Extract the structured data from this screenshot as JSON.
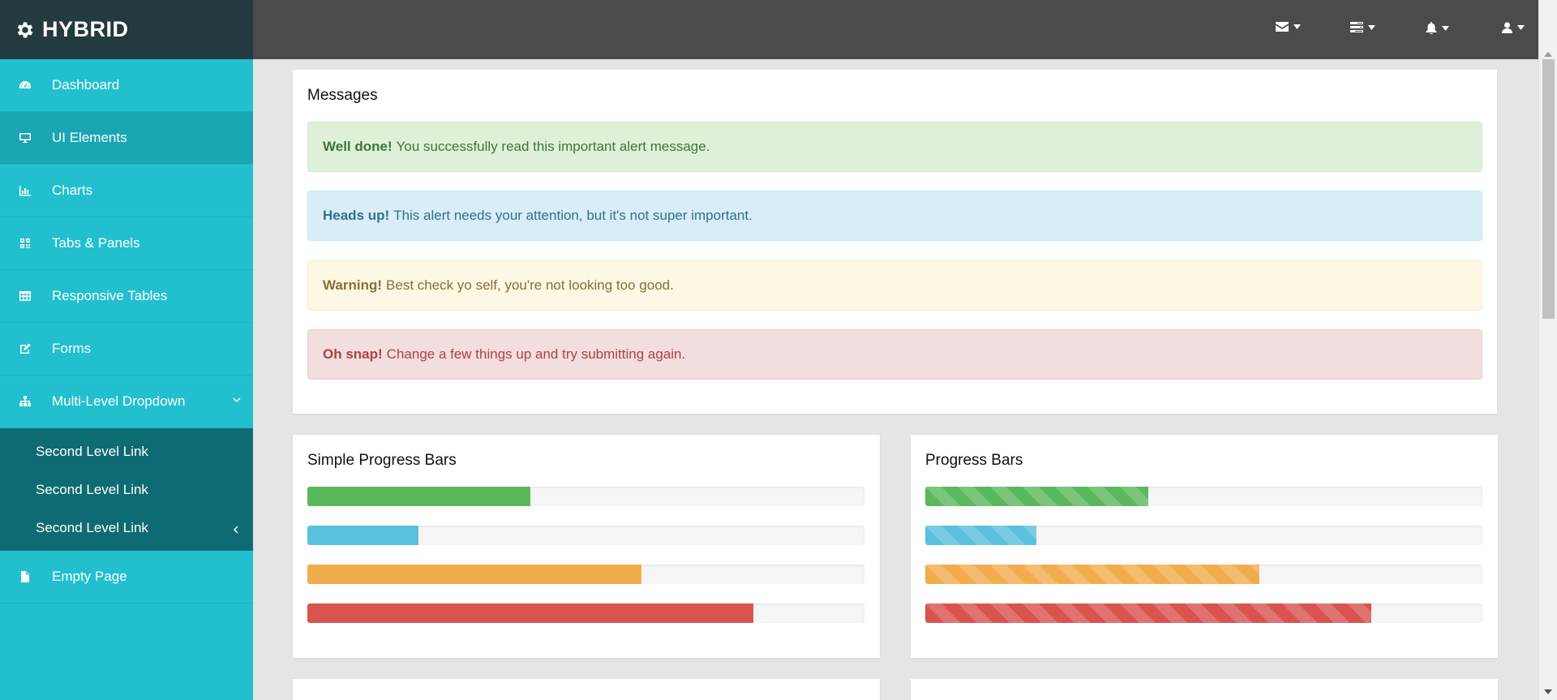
{
  "brand": {
    "name": "HYBRID",
    "icon": "gear-icon"
  },
  "sidebar": {
    "items": [
      {
        "label": "Dashboard",
        "icon": "dashboard-icon"
      },
      {
        "label": "UI Elements",
        "icon": "desktop-icon",
        "active": true
      },
      {
        "label": "Charts",
        "icon": "bar-chart-icon"
      },
      {
        "label": "Tabs & Panels",
        "icon": "qrcode-icon"
      },
      {
        "label": "Responsive Tables",
        "icon": "table-icon"
      },
      {
        "label": "Forms",
        "icon": "edit-icon"
      },
      {
        "label": "Multi-Level Dropdown",
        "icon": "sitemap-icon"
      },
      {
        "label": "Empty Page",
        "icon": "file-icon"
      }
    ],
    "sub_items": [
      {
        "label": "Second Level Link"
      },
      {
        "label": "Second Level Link"
      },
      {
        "label": "Second Level Link"
      }
    ]
  },
  "topbar": {
    "icons": [
      "envelope-icon",
      "tasks-icon",
      "bell-icon",
      "user-icon"
    ]
  },
  "messages": {
    "title": "Messages",
    "alerts": [
      {
        "type": "success",
        "strong": "Well done!",
        "text": "You successfully read this important alert message."
      },
      {
        "type": "info",
        "strong": "Heads up!",
        "text": "This alert needs your attention, but it's not super important."
      },
      {
        "type": "warning",
        "strong": "Warning!",
        "text": "Best check yo self, you're not looking too good."
      },
      {
        "type": "danger",
        "strong": "Oh snap!",
        "text": "Change a few things up and try submitting again."
      }
    ]
  },
  "simple_progress": {
    "title": "Simple Progress Bars",
    "bars": [
      {
        "type": "success",
        "value": 40
      },
      {
        "type": "info",
        "value": 20
      },
      {
        "type": "warning",
        "value": 60
      },
      {
        "type": "danger",
        "value": 80
      }
    ]
  },
  "striped_progress": {
    "title": "Progress Bars",
    "bars": [
      {
        "type": "success",
        "value": 40
      },
      {
        "type": "info",
        "value": 20
      },
      {
        "type": "warning",
        "value": 60
      },
      {
        "type": "danger",
        "value": 80
      }
    ]
  },
  "colors": {
    "sidebar": "#22bfcf",
    "sidebar_active": "#1aa5b3",
    "submenu": "#0f6b73",
    "brand_bg": "#233a3e",
    "topbar": "#4b4b4b",
    "success": "#5cb85c",
    "info": "#5bc0de",
    "warning": "#f0ad4e",
    "danger": "#d9534f"
  }
}
